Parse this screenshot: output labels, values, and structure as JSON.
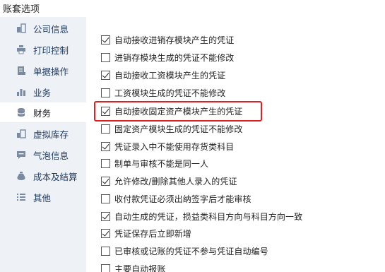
{
  "window": {
    "title": "账套选项"
  },
  "sidebar": {
    "items": [
      {
        "label": "公司信息",
        "icon": "building-icon",
        "active": false
      },
      {
        "label": "打印控制",
        "icon": "printer-icon",
        "active": false
      },
      {
        "label": "单据操作",
        "icon": "document-icon",
        "active": false
      },
      {
        "label": "业务",
        "icon": "bar-chart-icon",
        "active": false
      },
      {
        "label": "财务",
        "icon": "database-icon",
        "active": true
      },
      {
        "label": "虚拟库存",
        "icon": "inventory-icon",
        "active": false
      },
      {
        "label": "气泡信息",
        "icon": "chat-bubble-icon",
        "active": false
      },
      {
        "label": "成本及结算",
        "icon": "money-bag-icon",
        "active": false
      },
      {
        "label": "其他",
        "icon": "list-icon",
        "active": false
      }
    ]
  },
  "options": [
    {
      "label": "自动接收进销存模块产生的凭证",
      "checked": true
    },
    {
      "label": "进销存模块生成的凭证不能修改",
      "checked": false
    },
    {
      "label": "自动接收工资模块产生的凭证",
      "checked": true
    },
    {
      "label": "工资模块生成的凭证不能修改",
      "checked": false
    },
    {
      "label": "自动接收固定资产模块产生的凭证",
      "checked": true,
      "highlighted": true
    },
    {
      "label": "固定资产模块生成的凭证不能修改",
      "checked": false
    },
    {
      "label": "凭证录入中不能使用存货类科目",
      "checked": true
    },
    {
      "label": "制单与审核不能是同一人",
      "checked": false
    },
    {
      "label": "允许修改/删除其他人录入的凭证",
      "checked": true
    },
    {
      "label": "收付款凭证必须出纳签字后才能审核",
      "checked": false
    },
    {
      "label": "自动生成的凭证，损益类科目方向与科目方向一致",
      "checked": true
    },
    {
      "label": "凭证保存后立即新增",
      "checked": true
    },
    {
      "label": "已审核或记账的凭证不参与凭证自动编号",
      "checked": false
    },
    {
      "label": "主要自动报账",
      "checked": false
    }
  ],
  "colors": {
    "highlight": "#e02020",
    "sidebar_bg": "#eef1f5",
    "icon": "#7a8aa0"
  }
}
